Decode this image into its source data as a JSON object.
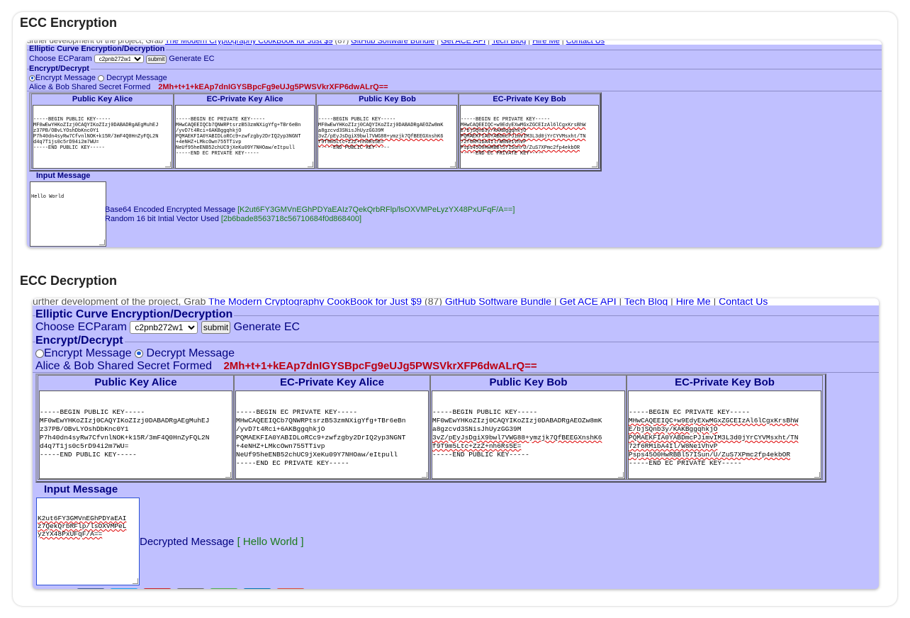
{
  "sections": {
    "encryption_title": "ECC Encryption",
    "decryption_title": "ECC Decryption"
  },
  "top_strip_text": "urther development of the project, Grab",
  "top_strip_links": [
    "The Modern Cryptography CookBook for Just $9",
    "GitHub Software Bundle",
    "Get ACE API",
    "Tech Blog",
    "Hire Me",
    "Contact Us"
  ],
  "top_strip_suffix": "(87)",
  "app": {
    "legend_main": "Elliptic Curve Encryption/Decryption",
    "choose_label": "Choose ECParam",
    "param_selected": "c2pnb272w1",
    "submit_label": "submit",
    "generate_label": "Generate EC",
    "legend_encdec": "Encrypt/Decrypt",
    "radio_encrypt": "Encrypt Message",
    "radio_decrypt": "Decrypt Message",
    "secret_label": "Alice & Bob Shared Secret Formed",
    "secret_value": "2Mh+t+1+kEAp7dnIGYSBpcFg9eUJg5PWSVkrXFP6dwALrQ==",
    "headers": [
      "Public Key Alice",
      "EC-Private Key Alice",
      "Public Key Bob",
      "EC-Private Key Bob"
    ],
    "keys": {
      "pub_alice": [
        "-----BEGIN PUBLIC KEY-----",
        "MF0wEwYHKoZIzj0CAQYIKoZIzj0DABADRgAEgMuhEJ",
        "z37PB/OBvLYOshDbKnc0Y1",
        "P7h40dn4syRw7CfvnlNOK+k15R/3mF4Q0HnZyFQL2N",
        "d4q7T1js0c5rD94i2m7WU=",
        "-----END PUBLIC KEY-----"
      ],
      "priv_alice": [
        "-----BEGIN EC PRIVATE KEY-----",
        "MHwCAQEEIQCb7QNWRPtsrzB53zmNXigYfg+TBr6eBn",
        "/yvD7t4Rci+6AKBggqhkjO",
        "PQMAEKFIA0YABIDLoRCc9+zwfzgby2DrIQ2yp3NGNT",
        "+4eNHZ+LMkcOwn755TTivp",
        "NeUf95heENB52chUC9jXeKu09Y7NHOaw/eItpull",
        "-----END EC PRIVATE KEY-----"
      ],
      "pub_bob": [
        "-----BEGIN PUBLIC KEY-----",
        "MF0wEwYHKoZIzj0CAQYIKoZIzj0DABADRgAEOZw8mK",
        "a8gzcvd3SNisJhUyzGG39M",
        "3vZ/pEyJsDgiX9bwl7VWG88+ymzjk7QfBEEGXnshK6",
        "f9T9m5Ltc+ZzZ+nh6Rs5E=",
        "-----END PUBLIC KEY-----"
      ],
      "priv_bob": [
        "-----BEGIN EC PRIVATE KEY-----",
        "MHwCAQEEIQC+w9EdyEXwMGxZGCEIzAl6lCgxKrsBhW",
        "E/bjSQnb3y/KAKBggqhkjO",
        "PQMAEKFIA0YABDmcPJimvIM3L3d0jYrCYVMsxht/TN",
        "72f6RMibA4Il/W8Ne1VhvP",
        "Psps45O0HwRBBl57ISun/U/ZuS7XPmc2fp4ekbOR",
        "-----END EC PRIVATE KEY-----"
      ]
    },
    "input_label": "Input Message"
  },
  "enc": {
    "message": "Hello World",
    "out1_label": "Base64 Encoded Encrypted Message",
    "out1_value": "[K2ut6FY3GMVnEGhPDYaEAIz7QekQrbRFlp/lsOXVMPeLyzYX48PxUFqF/A==]",
    "out2_label": "Random 16 bit Intial Vector Used",
    "out2_value": "[2b6bade8563718c56710684f0d868400]"
  },
  "dec": {
    "message_lines": [
      "K2ut6FY3GMVnEGhPDYaEAI",
      "z7QekQrbRFlp/lsOXVMPeL",
      "yzYX48PxUFqF/A=="
    ],
    "out_label": "Decrypted Message",
    "out_value": "[ Hello World ]"
  },
  "colors": {
    "panel_bg": "#c0c0ff",
    "heading": "#00007f",
    "secret": "#bb0011",
    "result": "#1a7a1a"
  },
  "icon_strip_colors": [
    "#3b5998",
    "#1da1f2",
    "#cb2027",
    "#666666",
    "#4caf50",
    "#0077b5",
    "#dd4b39"
  ]
}
